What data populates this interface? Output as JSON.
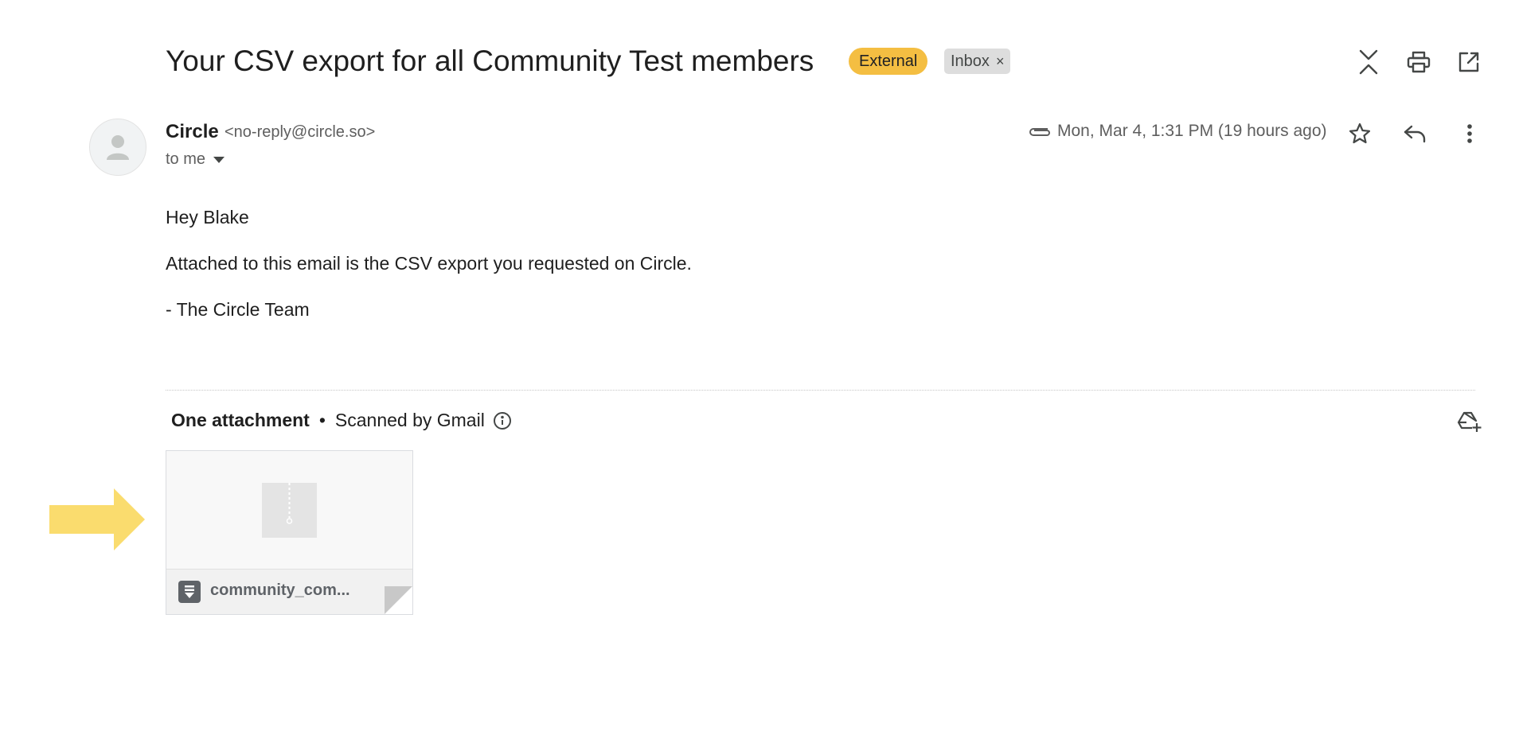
{
  "email": {
    "subject": "Your CSV export for all Community Test members",
    "labels": {
      "external": "External",
      "inbox": "Inbox",
      "inbox_remove": "×"
    },
    "sender": {
      "name": "Circle",
      "email": "<no-reply@circle.so>",
      "recipient": "to me"
    },
    "date": "Mon, Mar 4, 1:31 PM (19 hours ago)",
    "body": {
      "greeting": "Hey Blake",
      "line1": "Attached to this email is the CSV export you requested on Circle.",
      "signoff": "- The Circle Team"
    },
    "attachments": {
      "count_label": "One attachment",
      "separator": "•",
      "scan_label": "Scanned by Gmail",
      "items": [
        {
          "name": "community_com..."
        }
      ]
    }
  },
  "icons": {
    "toolbar": [
      "collapse-icon",
      "print-icon",
      "open-new-window-icon"
    ],
    "message_actions": [
      "attachment-icon",
      "star-icon",
      "reply-icon",
      "more-vert-icon"
    ],
    "attachment_actions": [
      "add-to-drive-icon",
      "info-icon"
    ],
    "annotation": "pointer-arrow"
  },
  "colors": {
    "external_label": "#f4be42",
    "inbox_label": "#dddddd",
    "annotation_arrow": "#fadc6e"
  }
}
